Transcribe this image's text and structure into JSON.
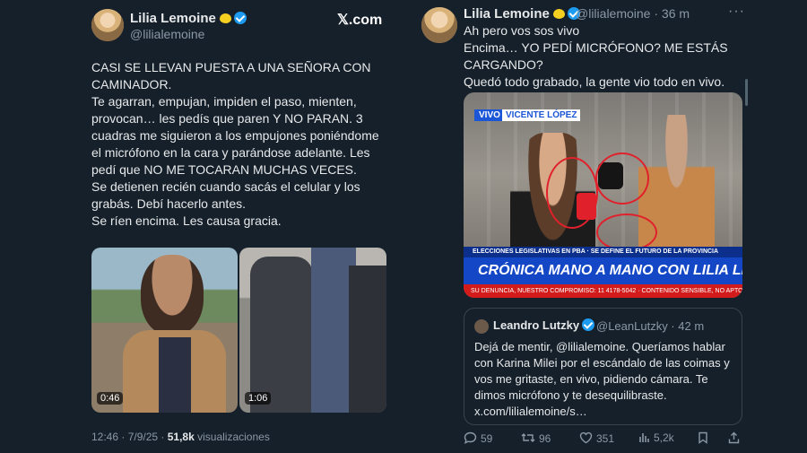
{
  "left_tweet": {
    "author_name": "Lilia Lemoine",
    "author_handle": "@lilialemoine",
    "brand": "𝕏.com",
    "text": "CASI SE LLEVAN PUESTA A UNA SEÑORA CON CAMINADOR.\nTe agarran, empujan, impiden el paso, mienten, provocan… les pedís que paren Y NO PARAN. 3 cuadras me siguieron a los empujones poniéndome el micrófono en la cara y parándose adelante. Les pedí que NO ME TOCARAN MUCHAS VECES.\nSe detienen recién cuando sacás el celular y los grabás. Debí hacerlo antes.\nSe ríen encima. Les causa gracia.",
    "video1_duration": "0:46",
    "video2_duration": "1:06",
    "timestamp": "12:46 · 7/9/25",
    "views_count": "51,8k",
    "views_label": "visualizaciones"
  },
  "right_tweet": {
    "author_name": "Lilia Lemoine",
    "author_handle": "@lilialemoine",
    "time": "· 36 m",
    "more_label": "···",
    "text": "Ah pero vos sos vivo\nEncima… YO PEDÍ MICRÓFONO? ME ESTÁS CARGANDO?\nQuedó todo grabado, la gente vio todo en vivo.",
    "video": {
      "live_label": "VIVO",
      "place_label": "VICENTE LÓPEZ",
      "lower_third": "ELECCIONES LEGISLATIVAS EN PBA · SE DEFINE EL FUTURO DE LA PROVINCIA",
      "banner": "CRÓNICA MANO A MANO CON LILIA LEMOINE",
      "ticker": "SU DENUNCIA, NUESTRO COMPROMISO: 11 4178-5042 · CONTENIDO SENSIBLE, NO APTO PARA MENORES"
    },
    "quote": {
      "author_name": "Leandro Lutzky",
      "author_handle": "@LeanLutzky · 42 m",
      "text": "Dejá de mentir, @lilialemoine. Queríamos hablar con Karina Milei por el escándalo de las coimas y vos me gritaste, en vivo, pidiendo cámara. Te dimos micrófono y te desequilibraste. x.com/lilialemoine/s…"
    },
    "actions": {
      "replies": "59",
      "reposts": "96",
      "likes": "351",
      "views": "5,2k"
    }
  },
  "colors": {
    "background": "#15202b",
    "verified": "#1d9bf0",
    "muted_text": "#8b98a5"
  }
}
